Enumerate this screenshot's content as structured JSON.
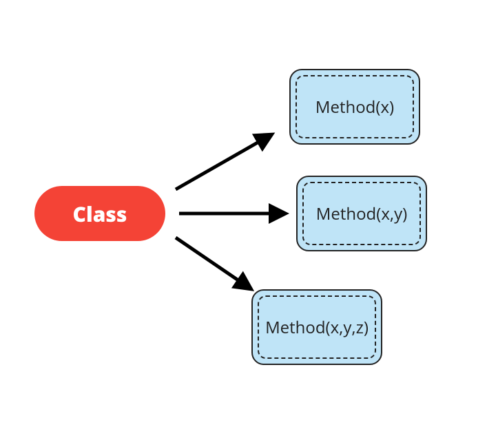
{
  "diagram": {
    "source_label": "Class",
    "methods": [
      {
        "label": "Method(x)"
      },
      {
        "label": "Method(x,y)"
      },
      {
        "label": "Method(x,y,z)"
      }
    ]
  }
}
